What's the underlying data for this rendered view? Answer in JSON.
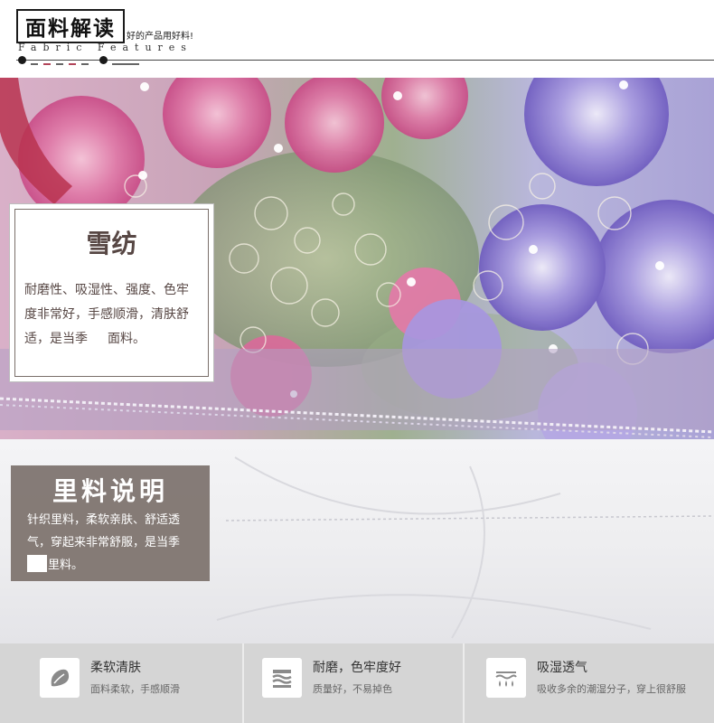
{
  "header": {
    "title": "面料解读",
    "subtitle": "好的产品用好料!",
    "title_en": "Fabric Features"
  },
  "chiffon_card": {
    "title": "雪纺",
    "lines": [
      "耐磨性、吸湿性、强度、色牢",
      "度非常好，手感顺滑，清肤舒",
      "适，是当季",
      "面料。"
    ]
  },
  "lining_card": {
    "title": "里料说明",
    "lines": [
      "针织里料，柔软亲肤、舒适透",
      "气，穿起来非常舒服，是当季",
      "里料。"
    ]
  },
  "features": [
    {
      "icon": "feather-icon",
      "title": "柔软清肤",
      "desc": "面料柔软，手感顺滑"
    },
    {
      "icon": "wear-resistant-icon",
      "title": "耐磨，色牢度好",
      "desc": "质量好，不易掉色"
    },
    {
      "icon": "moisture-absorb-icon",
      "title": "吸湿透气",
      "desc": "吸收多余的潮湿分子，穿上很舒服"
    }
  ],
  "colors": {
    "card_text": "#574744",
    "lining_bg": "#7d726d",
    "strip_bg": "#d5d5d5",
    "accent_pink": "#d34a7a",
    "accent_purple": "#8a78d0"
  }
}
